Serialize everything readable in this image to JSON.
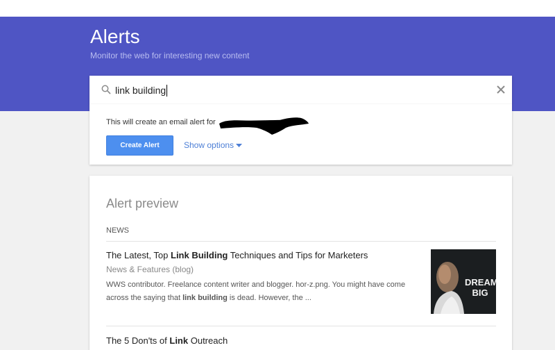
{
  "header": {
    "title": "Alerts",
    "subtitle": "Monitor the web for interesting new content"
  },
  "search": {
    "value": "link building",
    "icon": "search-icon",
    "clear_icon": "close-icon"
  },
  "create": {
    "info_text": "This will create an email alert for",
    "button_label": "Create Alert",
    "options_label": "Show options"
  },
  "preview": {
    "title": "Alert preview",
    "section_label": "NEWS",
    "articles": [
      {
        "title_parts": [
          "The Latest, Top ",
          "Link Building",
          " Techniques and Tips for Marketers"
        ],
        "source": "News & Features (blog)",
        "snippet_parts": [
          "WWS contributor. Freelance content writer and blogger. hor-z.png. You might have come across the saying that ",
          "link building",
          " is dead. However, the ..."
        ],
        "thumbnail_text": [
          "DREAM",
          "BIG"
        ]
      },
      {
        "title_parts": [
          "The 5 Don'ts of ",
          "Link",
          " Outreach"
        ]
      }
    ]
  },
  "colors": {
    "header_bg": "#4f55c4",
    "button_bg": "#4d8fef",
    "link": "#4d7fd6",
    "page_bg": "#f1f1f1"
  }
}
